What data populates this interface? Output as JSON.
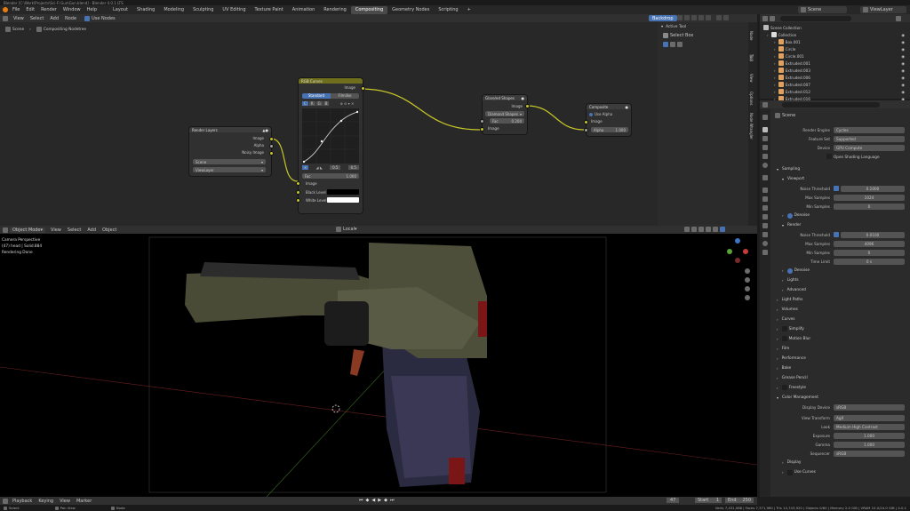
{
  "window": {
    "title": "Blender [C:\\Work\\Projects\\Sci-Fi Gun\\Gun.blend] - Blender 4.0.1 LTS"
  },
  "topbar": {
    "menus": [
      "File",
      "Edit",
      "Render",
      "Window",
      "Help"
    ],
    "workspace_tabs": [
      "Layout",
      "Shading",
      "Modeling",
      "Sculpting",
      "UV Editing",
      "Texture Paint",
      "Animation",
      "Rendering",
      "Compositing",
      "Geometry Nodes",
      "Scripting"
    ],
    "active_tab": "Compositing",
    "add_tab": "+",
    "scene": "Scene",
    "view_layer": "ViewLayer"
  },
  "node_editor": {
    "menus": [
      "View",
      "Select",
      "Add",
      "Node"
    ],
    "use_nodes": "Use Nodes",
    "backdrop": "Backdrop",
    "breadcrumb": [
      "Scene",
      "Compositing Nodetree"
    ],
    "render_layers": {
      "title": "Render Layers",
      "outputs": [
        "Image",
        "Alpha",
        "Noisy Image"
      ],
      "scene": "Scene",
      "layer": "ViewLayer"
    },
    "rgb_curves": {
      "title": "RGB Curves",
      "tabs": [
        "Standard",
        "Filmlike"
      ],
      "channels": [
        "C",
        "R",
        "G",
        "B"
      ],
      "fac_label": "Fac",
      "fac": "1.000",
      "output": "Image",
      "inputs": [
        "Image",
        "Black Level",
        "White Level"
      ],
      "x": "0.5",
      "y": "0.5"
    },
    "glare": {
      "title": "Glare/ed Shapes",
      "output": "Image",
      "mode": "Diamond Shapes",
      "fac_label": "Fac",
      "fac": "0.200",
      "input": "Image"
    },
    "composite": {
      "title": "Composite",
      "use_alpha": "Use Alpha",
      "input": "Image",
      "alpha_label": "Alpha",
      "alpha": "1.000"
    },
    "side_tabs": [
      "Node",
      "Tool",
      "View",
      "Options",
      "Node Wrangler"
    ],
    "active_tool": {
      "title": "Active Tool",
      "name": "Select Box"
    }
  },
  "viewport": {
    "mode": "Object Mode",
    "menus": [
      "View",
      "Select",
      "Add",
      "Object"
    ],
    "orientation": "Local",
    "overlay_lines": [
      "Camera Perspective",
      "(47) head | Solid.884",
      "Rendering Done"
    ]
  },
  "outliner": {
    "title": "Scene Collection",
    "items": [
      {
        "name": "Collection",
        "indent": 0
      },
      {
        "name": "Box.001",
        "indent": 1
      },
      {
        "name": "Circle",
        "indent": 1
      },
      {
        "name": "Circle.001",
        "indent": 1
      },
      {
        "name": "Extruded.001",
        "indent": 1
      },
      {
        "name": "Extruded.003",
        "indent": 1
      },
      {
        "name": "Extruded.006",
        "indent": 1
      },
      {
        "name": "Extruded.007",
        "indent": 1
      },
      {
        "name": "Extruded.012",
        "indent": 1
      },
      {
        "name": "Extruded.016",
        "indent": 1
      }
    ]
  },
  "properties": {
    "context": "Scene",
    "render_engine_label": "Render Engine",
    "render_engine": "Cycles",
    "feature_set_label": "Feature Set",
    "feature_set": "Supported",
    "device_label": "Device",
    "device": "GPU Compute",
    "osl": "Open Shading Language",
    "sampling": "Sampling",
    "viewport": "Viewport",
    "noise_threshold_label": "Noise Threshold",
    "vp_noise": "0.1000",
    "max_samples_label": "Max Samples",
    "vp_max": "1024",
    "min_samples_label": "Min Samples",
    "vp_min": "0",
    "denoise": "Denoise",
    "render": "Render",
    "r_noise": "0.0100",
    "r_max": "4096",
    "r_min": "0",
    "time_limit_label": "Time Limit",
    "r_time": "0 s",
    "sub_sections": [
      "Lights",
      "Advanced"
    ],
    "sections": [
      "Light Paths",
      "Volumes",
      "Curves",
      "Simplify",
      "Motion Blur",
      "Film",
      "Performance",
      "Bake",
      "Grease Pencil",
      "Freestyle",
      "Color Management"
    ],
    "display_device_label": "Display Device",
    "display_device": "sRGB",
    "view_transform_label": "View Transform",
    "view_transform": "AgX",
    "look_label": "Look",
    "look": "Medium High Contrast",
    "exposure_label": "Exposure",
    "exposure": "1.000",
    "gamma_label": "Gamma",
    "gamma": "1.000",
    "sequencer_label": "Sequencer",
    "sequencer": "sRGB",
    "display": "Display",
    "use_curves": "Use Curves"
  },
  "timeline": {
    "menus": [
      "Playback",
      "Keying",
      "View",
      "Marker"
    ],
    "frame": "47",
    "start_label": "Start",
    "start": "1",
    "end_label": "End",
    "end": "250"
  },
  "status": {
    "left": [
      "Select",
      "Pan View",
      "Node"
    ],
    "right": "Verts 7,431,088 | Faces 7,371,960 | Tris 14,743,920 | Objects 0/60 | Memory 2.0 GiB | VRAM 10.0/24.0 GiB | 4.0.1"
  },
  "colors": {
    "accent": "#4772b3",
    "node_header_curves": "#6e6e1d",
    "node_header_default": "#3c3c3c",
    "link": "#c7c729"
  }
}
